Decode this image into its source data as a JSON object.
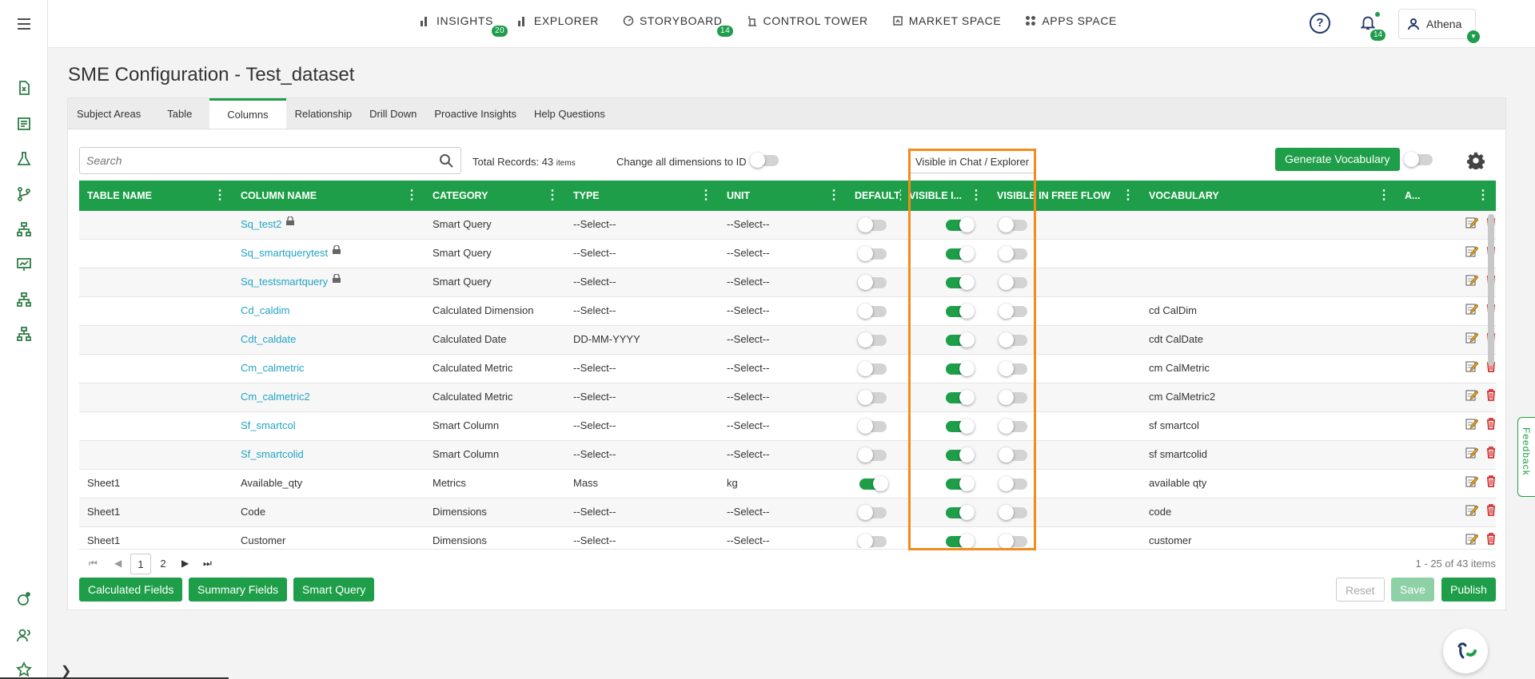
{
  "nav": [
    {
      "label": "INSIGHTS",
      "badge": "20"
    },
    {
      "label": "EXPLORER",
      "badge": ""
    },
    {
      "label": "STORYBOARD",
      "badge": "14"
    },
    {
      "label": "CONTROL TOWER",
      "badge": ""
    },
    {
      "label": "MARKET SPACE",
      "badge": ""
    },
    {
      "label": "APPS SPACE",
      "badge": ""
    }
  ],
  "header": {
    "help_symbol": "?",
    "notif_badge": "14",
    "user_name": "Athena"
  },
  "page_title": "SME Configuration - Test_dataset",
  "tabs": [
    "Subject Areas",
    "Table",
    "Columns",
    "Relationship",
    "Drill Down",
    "Proactive Insights",
    "Help Questions"
  ],
  "toolbar": {
    "search_placeholder": "Search",
    "records_label": "Total Records: 43",
    "records_unit": "items",
    "change_label": "Change all dimensions to ID",
    "visible_label": "Visible in Chat / Explorer",
    "generate_label": "Generate Vocabulary"
  },
  "columns": [
    "TABLE NAME",
    "COLUMN NAME",
    "CATEGORY",
    "TYPE",
    "UNIT",
    "DEFAULT",
    "VISIBLE I...",
    "VISIBLE IN FREE FLOW",
    "VOCABULARY",
    "A..."
  ],
  "rows": [
    {
      "table": "",
      "column": "Sq_test2",
      "locked": true,
      "category": "Smart Query",
      "type": "--Select--",
      "unit": "--Select--",
      "default": false,
      "visible": true,
      "freeflow": false,
      "vocab": ""
    },
    {
      "table": "",
      "column": "Sq_smartquerytest",
      "locked": true,
      "category": "Smart Query",
      "type": "--Select--",
      "unit": "--Select--",
      "default": false,
      "visible": true,
      "freeflow": false,
      "vocab": ""
    },
    {
      "table": "",
      "column": "Sq_testsmartquery",
      "locked": true,
      "category": "Smart Query",
      "type": "--Select--",
      "unit": "--Select--",
      "default": false,
      "visible": true,
      "freeflow": false,
      "vocab": ""
    },
    {
      "table": "",
      "column": "Cd_caldim",
      "locked": false,
      "category": "Calculated Dimension",
      "type": "--Select--",
      "unit": "--Select--",
      "default": false,
      "visible": true,
      "freeflow": false,
      "vocab": "cd CalDim"
    },
    {
      "table": "",
      "column": "Cdt_caldate",
      "locked": false,
      "category": "Calculated Date",
      "type": "DD-MM-YYYY",
      "unit": "--Select--",
      "default": false,
      "visible": true,
      "freeflow": false,
      "vocab": "cdt CalDate"
    },
    {
      "table": "",
      "column": "Cm_calmetric",
      "locked": false,
      "category": "Calculated Metric",
      "type": "--Select--",
      "unit": "--Select--",
      "default": false,
      "visible": true,
      "freeflow": false,
      "vocab": "cm CalMetric"
    },
    {
      "table": "",
      "column": "Cm_calmetric2",
      "locked": false,
      "category": "Calculated Metric",
      "type": "--Select--",
      "unit": "--Select--",
      "default": false,
      "visible": true,
      "freeflow": false,
      "vocab": "cm CalMetric2"
    },
    {
      "table": "",
      "column": "Sf_smartcol",
      "locked": false,
      "category": "Smart Column",
      "type": "--Select--",
      "unit": "--Select--",
      "default": false,
      "visible": true,
      "freeflow": false,
      "vocab": "sf smartcol"
    },
    {
      "table": "",
      "column": "Sf_smartcolid",
      "locked": false,
      "category": "Smart Column",
      "type": "--Select--",
      "unit": "--Select--",
      "default": false,
      "visible": true,
      "freeflow": false,
      "vocab": "sf smartcolid"
    },
    {
      "table": "Sheet1",
      "column": "Available_qty",
      "locked": false,
      "category": "Metrics",
      "type": "Mass",
      "unit": "kg",
      "default": true,
      "visible": true,
      "freeflow": false,
      "vocab": "available qty"
    },
    {
      "table": "Sheet1",
      "column": "Code",
      "locked": false,
      "category": "Dimensions",
      "type": "--Select--",
      "unit": "--Select--",
      "default": false,
      "visible": true,
      "freeflow": false,
      "vocab": "code"
    },
    {
      "table": "Sheet1",
      "column": "Customer",
      "locked": false,
      "category": "Dimensions",
      "type": "--Select--",
      "unit": "--Select--",
      "default": false,
      "visible": true,
      "freeflow": false,
      "vocab": "customer"
    }
  ],
  "pager": {
    "pages": [
      "1",
      "2"
    ],
    "current": "1",
    "summary": "1 - 25 of 43 items"
  },
  "buttons": {
    "calculated": "Calculated Fields",
    "summary": "Summary Fields",
    "smart_query": "Smart Query",
    "reset": "Reset",
    "save": "Save",
    "publish": "Publish"
  },
  "feedback_label": "Feedback",
  "colors": {
    "accent": "#1e9e48",
    "link": "#23a3c4",
    "highlight": "#f28c1e"
  }
}
